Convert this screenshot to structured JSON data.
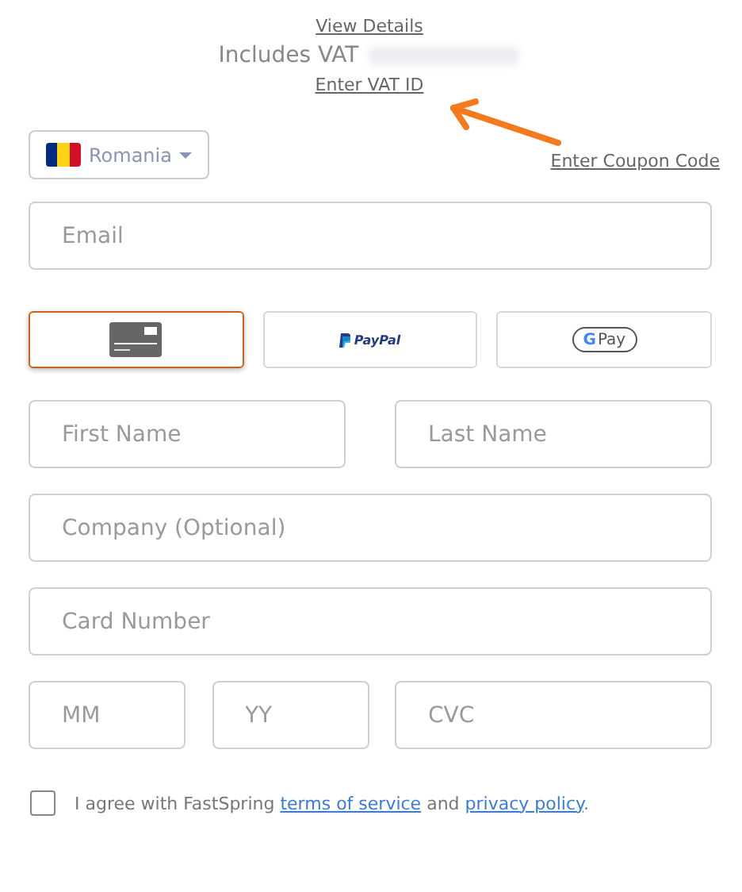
{
  "summary": {
    "details_link": "View Details",
    "vat_text": "Includes VAT",
    "vat_id_link": "Enter VAT ID"
  },
  "country": {
    "label": "Romania"
  },
  "coupon_link": "Enter Coupon Code",
  "email": {
    "placeholder": "Email"
  },
  "payment_methods": [
    {
      "kind": "card",
      "selected": true
    },
    {
      "kind": "paypal",
      "label": "PayPal",
      "selected": false
    },
    {
      "kind": "gpay",
      "mark": "G",
      "label": "Pay",
      "selected": false
    }
  ],
  "fields": [
    [
      {
        "placeholder": "First Name"
      },
      {
        "placeholder": "Last Name"
      }
    ],
    [
      {
        "placeholder": "Company (Optional)"
      }
    ],
    [
      {
        "placeholder": "Card Number"
      }
    ],
    [
      {
        "placeholder": "MM"
      },
      {
        "placeholder": "YY"
      },
      {
        "placeholder": "CVC"
      }
    ]
  ],
  "agreement": {
    "checked": false,
    "text": "I agree with FastSpring",
    "terms_link": "terms of service",
    "joiner": "and",
    "privacy_link": "privacy policy",
    "end": "."
  }
}
